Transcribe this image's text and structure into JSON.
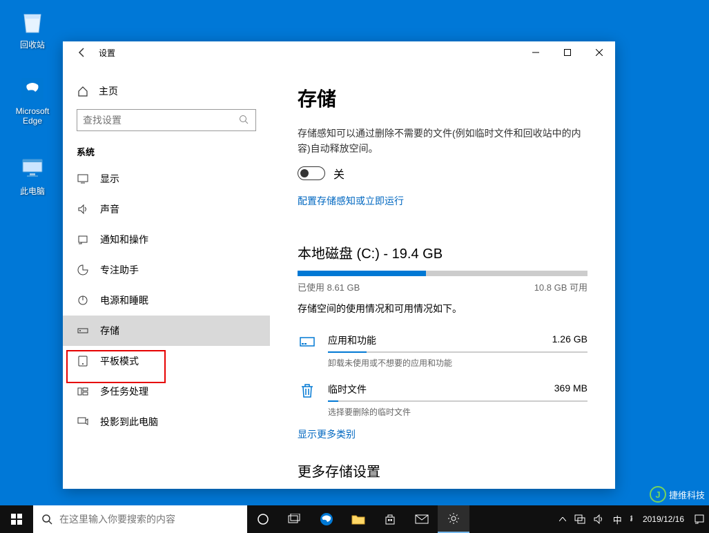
{
  "desktop": {
    "recycle_bin": "回收站",
    "edge": "Microsoft Edge",
    "this_pc": "此电脑"
  },
  "window": {
    "title": "设置",
    "home": "主页",
    "search_placeholder": "查找设置",
    "category": "系统",
    "nav": {
      "display": "显示",
      "sound": "声音",
      "notifications": "通知和操作",
      "focus": "专注助手",
      "power": "电源和睡眠",
      "storage": "存储",
      "tablet": "平板模式",
      "multitask": "多任务处理",
      "project": "投影到此电脑"
    }
  },
  "main": {
    "title": "存储",
    "sense_desc": "存储感知可以通过删除不需要的文件(例如临时文件和回收站中的内容)自动释放空间。",
    "toggle_label": "关",
    "config_link": "配置存储感知或立即运行",
    "disk": {
      "title": "本地磁盘 (C:) - 19.4 GB",
      "used_label": "已使用 8.61 GB",
      "free_label": "10.8 GB 可用",
      "usage_desc": "存储空间的使用情况和可用情况如下。"
    },
    "items": {
      "apps": {
        "name": "应用和功能",
        "size": "1.26 GB",
        "sub": "卸载未使用或不想要的应用和功能"
      },
      "temp": {
        "name": "临时文件",
        "size": "369 MB",
        "sub": "选择要删除的临时文件"
      }
    },
    "more_categories": "显示更多类别",
    "more_settings": "更多存储设置"
  },
  "taskbar": {
    "search_placeholder": "在这里输入你要搜索的内容",
    "ime1": "中",
    "ime2": "៛",
    "date": "2019/12/16"
  },
  "watermark": {
    "text": "捷维科技"
  },
  "chart_data": {
    "type": "bar",
    "title": "本地磁盘 (C:) - 19.4 GB",
    "categories": [
      "已使用",
      "可用"
    ],
    "values": [
      8.61,
      10.8
    ],
    "unit": "GB",
    "total": 19.4,
    "breakdown": [
      {
        "name": "应用和功能",
        "value_gb": 1.26
      },
      {
        "name": "临时文件",
        "value_gb": 0.369
      }
    ]
  }
}
